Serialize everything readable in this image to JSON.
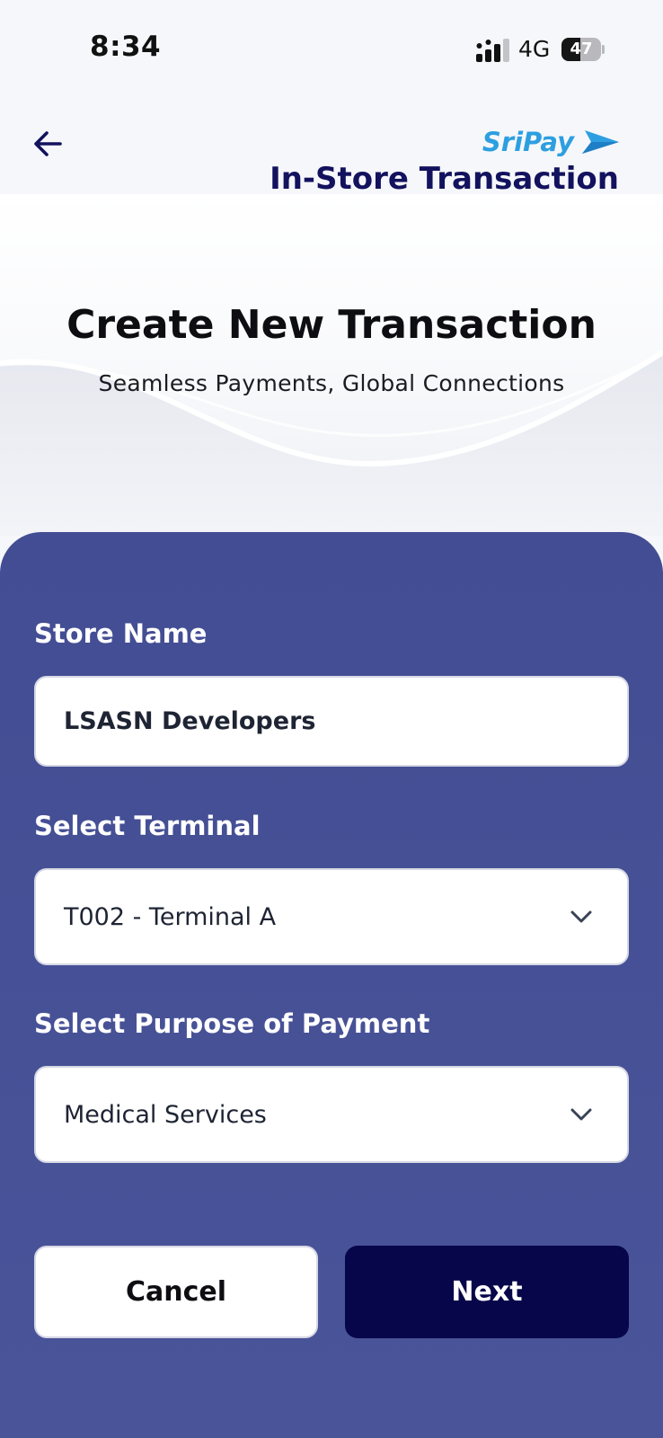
{
  "status_bar": {
    "time": "8:34",
    "network": "4G",
    "battery_percent": "47",
    "battery_level": 0.47
  },
  "header": {
    "logo_text": "SriPay",
    "title": "In-Store Transaction"
  },
  "hero": {
    "title": "Create New Transaction",
    "subtitle": "Seamless Payments, Global Connections"
  },
  "form": {
    "store_name": {
      "label": "Store Name",
      "value": "LSASN Developers"
    },
    "terminal": {
      "label": "Select Terminal",
      "value": "T002 - Terminal A"
    },
    "purpose": {
      "label": "Select Purpose of Payment",
      "value": "Medical Services"
    }
  },
  "actions": {
    "cancel_label": "Cancel",
    "next_label": "Next"
  },
  "colors": {
    "panel": "#434d93",
    "primary_button": "#07064a",
    "title_navy": "#13125e",
    "logo_blue": "#2d9fe0"
  },
  "icons": [
    "signal-icon",
    "battery-icon",
    "back-arrow-icon",
    "sripay-logo-icon",
    "chevron-down-icon"
  ]
}
